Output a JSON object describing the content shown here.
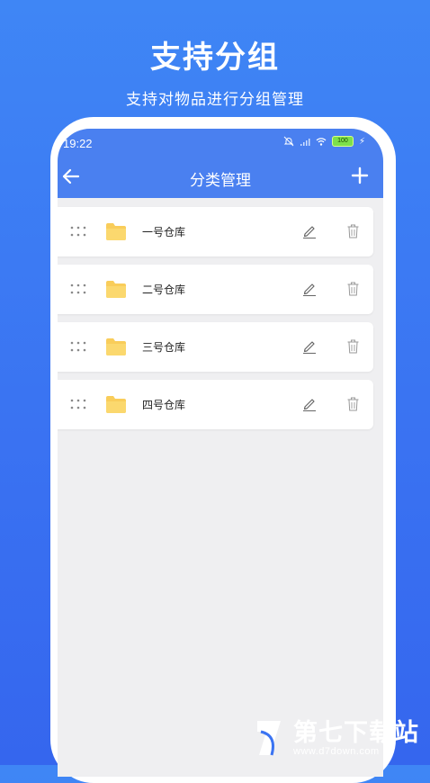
{
  "promo": {
    "headline": "支持分组",
    "subline": "支持对物品进行分组管理"
  },
  "status_bar": {
    "time": "19:22",
    "battery": "100",
    "icons": [
      "mute-bell-icon",
      "signal-icon",
      "wifi-icon",
      "battery-icon",
      "charging-icon"
    ]
  },
  "header": {
    "title": "分类管理",
    "back_icon": "arrow-left-icon",
    "add_icon": "plus-icon"
  },
  "categories": [
    {
      "name": "一号仓库"
    },
    {
      "name": "二号仓库"
    },
    {
      "name": "三号仓库"
    },
    {
      "name": "四号仓库"
    }
  ],
  "colors": {
    "app_bar": "#4a80f0",
    "folder": "#f9cd5a",
    "background": "#3f86f5"
  },
  "watermark": {
    "name": "第七下载站",
    "url": "www.d7down.com"
  }
}
